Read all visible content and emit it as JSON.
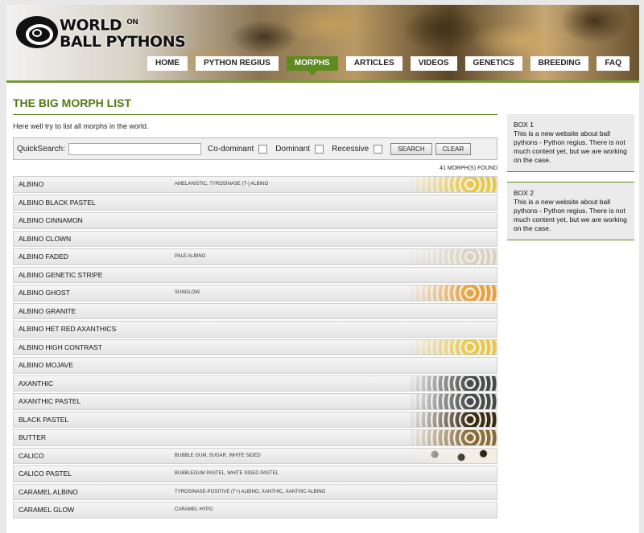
{
  "header": {
    "logo_line1": "WORLD",
    "logo_on": "ON",
    "logo_line2": "BALL PYTHONS",
    "nav": [
      {
        "label": "HOME",
        "active": false
      },
      {
        "label": "PYTHON REGIUS",
        "active": false
      },
      {
        "label": "MORPHS",
        "active": true
      },
      {
        "label": "ARTICLES",
        "active": false
      },
      {
        "label": "VIDEOS",
        "active": false
      },
      {
        "label": "GENETICS",
        "active": false
      },
      {
        "label": "BREEDING",
        "active": false
      },
      {
        "label": "FAQ",
        "active": false
      }
    ]
  },
  "main": {
    "title": "THE BIG MORPH LIST",
    "intro": "Here well try to list all morphs in the world.",
    "search": {
      "label": "QuickSearch:",
      "value": "",
      "codominant_label": "Co-dominant",
      "dominant_label": "Dominant",
      "recessive_label": "Recessive",
      "search_button": "SEARCH",
      "clear_button": "CLEAR"
    },
    "found_text": "41 MORPH(S) FOUND",
    "morphs": [
      {
        "name": "ALBINO",
        "alias": "AMELANISTIC, TYROSINASE (T-) ALBINO",
        "thumb": "yellow"
      },
      {
        "name": "ALBINO BLACK PASTEL",
        "alias": "",
        "thumb": ""
      },
      {
        "name": "ALBINO CINNAMON",
        "alias": "",
        "thumb": ""
      },
      {
        "name": "ALBINO CLOWN",
        "alias": "",
        "thumb": ""
      },
      {
        "name": "ALBINO FADED",
        "alias": "PALE ALBINO",
        "thumb": "pale"
      },
      {
        "name": "ALBINO GENETIC STRIPE",
        "alias": "",
        "thumb": ""
      },
      {
        "name": "ALBINO GHOST",
        "alias": "SUNGLOW",
        "thumb": "orange"
      },
      {
        "name": "ALBINO GRANITE",
        "alias": "",
        "thumb": ""
      },
      {
        "name": "ALBINO HET RED AXANTHICS",
        "alias": "",
        "thumb": ""
      },
      {
        "name": "ALBINO HIGH CONTRAST",
        "alias": "",
        "thumb": "yellow"
      },
      {
        "name": "ALBINO MOJAVE",
        "alias": "",
        "thumb": ""
      },
      {
        "name": "AXANTHIC",
        "alias": "",
        "thumb": "gray"
      },
      {
        "name": "AXANTHIC PASTEL",
        "alias": "",
        "thumb": "gray"
      },
      {
        "name": "BLACK PASTEL",
        "alias": "",
        "thumb": "brown"
      },
      {
        "name": "BUTTER",
        "alias": "",
        "thumb": "tan"
      },
      {
        "name": "CALICO",
        "alias": "BUBBLE GUM, SUGAR, WHITE SIDED",
        "thumb": "spots"
      },
      {
        "name": "CALICO PASTEL",
        "alias": "BUBBLEGUM PASTEL, WHITE SIDED PASTEL",
        "thumb": ""
      },
      {
        "name": "CARAMEL ALBINO",
        "alias": "TYROSINASE-POSITIVE (T+) ALBINO, XANTHIC, XANTHIC ALBINO",
        "thumb": ""
      },
      {
        "name": "CARAMEL GLOW",
        "alias": "CARAMEL HYPO",
        "thumb": ""
      }
    ]
  },
  "sidebar": {
    "boxes": [
      {
        "title": "BOX 1",
        "text": "This is a new website about ball pythons - Python regius. There is not much content yet, but we are working on the case."
      },
      {
        "title": "BOX 2",
        "text": "This is a new website about ball pythons - Python regius. There is not much content yet, but we are working on the case."
      }
    ]
  },
  "thumb_colors": {
    "yellow": "#e8c84a",
    "pale": "#d9d2c4",
    "orange": "#e8a040",
    "gray": "#444a50",
    "brown": "#3a2a18",
    "tan": "#8a6a3a",
    "spots": "#2e2418"
  }
}
